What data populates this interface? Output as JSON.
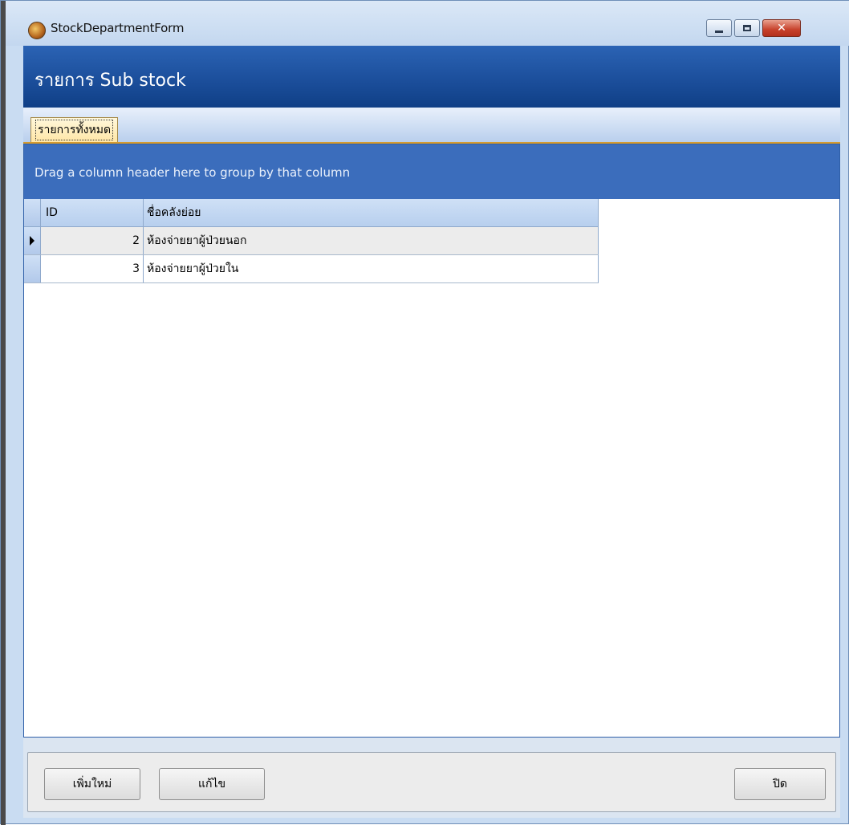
{
  "window": {
    "title": "StockDepartmentForm"
  },
  "header": {
    "title": "รายการ Sub stock"
  },
  "tabs": [
    {
      "label": "รายการทั้งหมด",
      "active": true
    }
  ],
  "grid": {
    "group_panel_text": "Drag a column header here to group by that column",
    "columns": [
      {
        "label": "ID"
      },
      {
        "label": "ชื่อคลังย่อย"
      }
    ],
    "rows": [
      {
        "id": "2",
        "name": "ห้องจ่ายยาผู้ป่วยนอก",
        "current": true
      },
      {
        "id": "3",
        "name": "ห้องจ่ายยาผู้ป่วยใน",
        "current": false
      }
    ]
  },
  "buttons": {
    "add_label": "เพิ่มใหม่",
    "edit_label": "แก้ไข",
    "close_label": "ปิด"
  },
  "colors": {
    "header_band": "#1c4f9c",
    "group_panel": "#3b6dbc",
    "tab_accent": "#d59b2f"
  },
  "icons": {
    "app": "app-icon",
    "minimize": "minimize-icon",
    "maximize": "maximize-icon",
    "close": "close-icon",
    "row_indicator": "row-pointer-icon"
  }
}
